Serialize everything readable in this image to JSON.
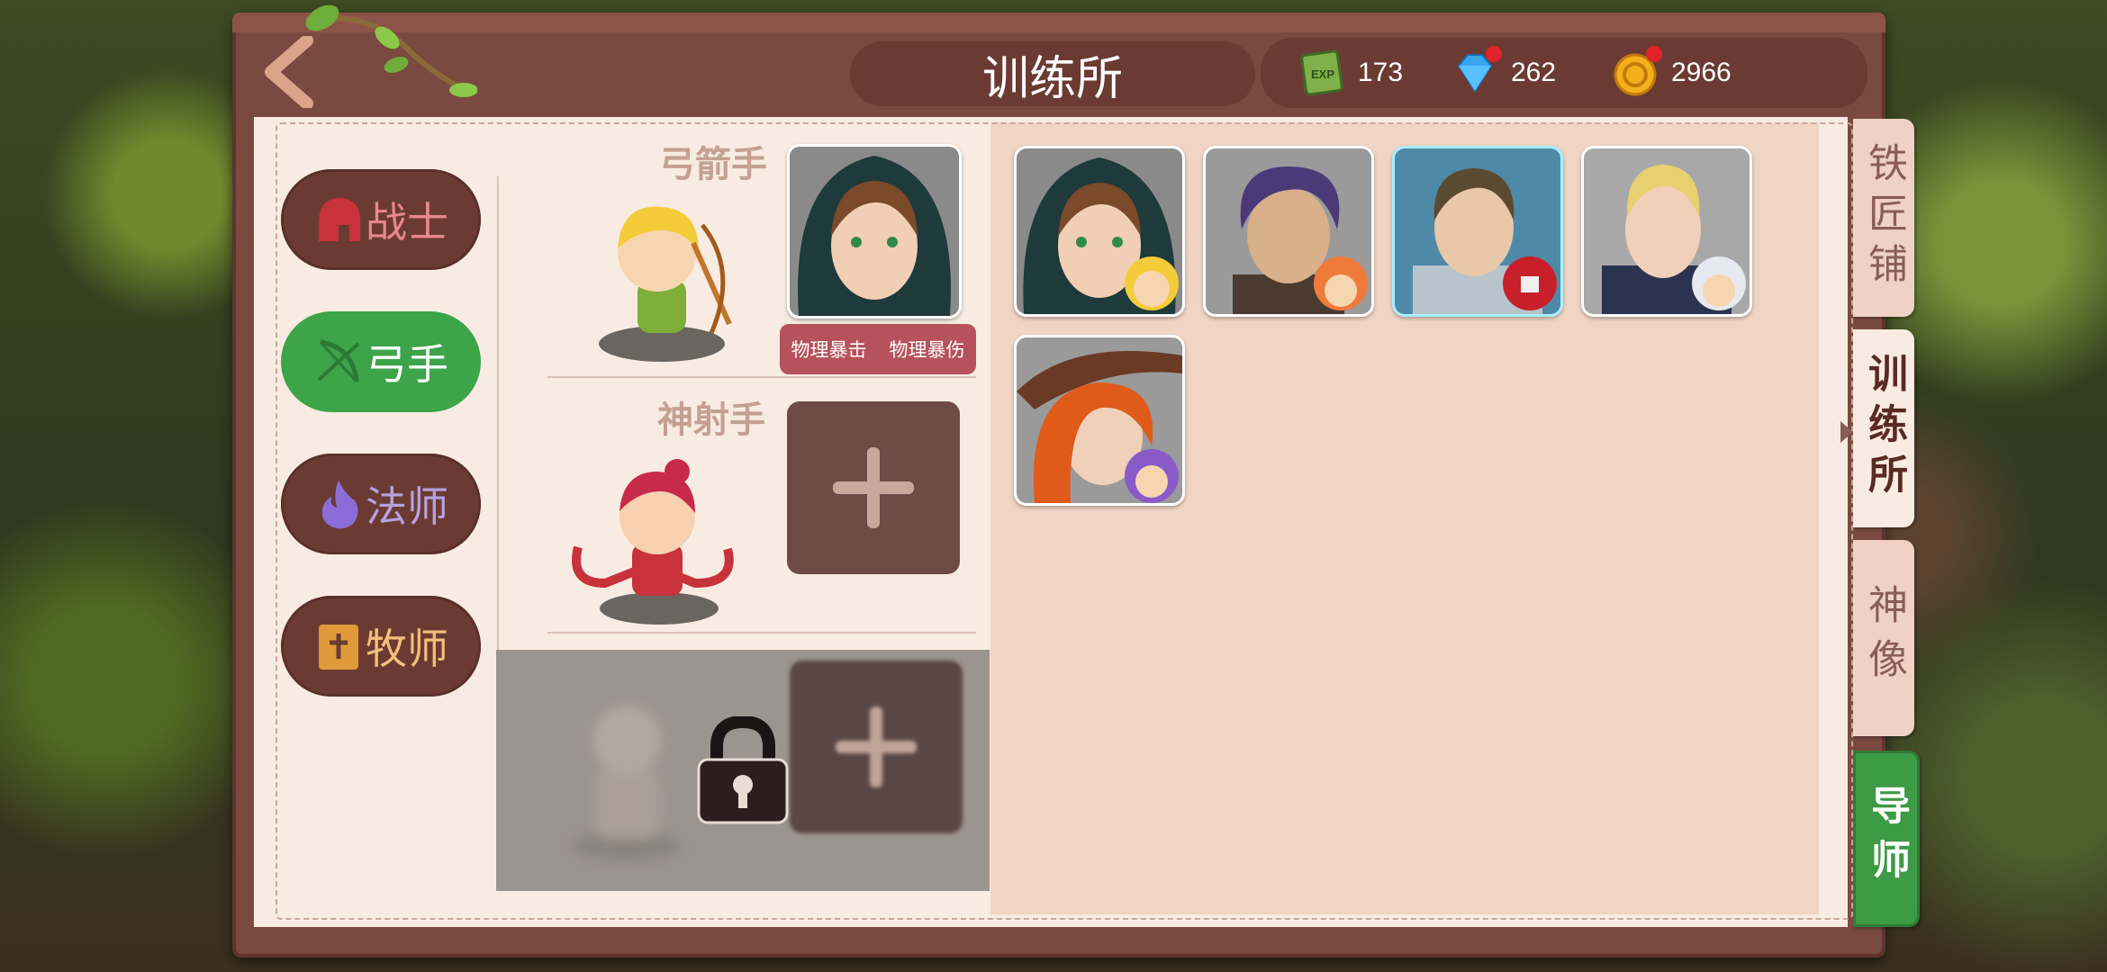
{
  "header": {
    "title": "训练所",
    "back_icon": "back-arrow-icon"
  },
  "currencies": [
    {
      "icon": "exp-book-icon",
      "value": "173",
      "has_dot": false
    },
    {
      "icon": "diamond-icon",
      "value": "262",
      "has_dot": true
    },
    {
      "icon": "gold-coin-icon",
      "value": "2966",
      "has_dot": true
    }
  ],
  "classes": [
    {
      "icon": "helmet-icon",
      "label": "战士",
      "active": false
    },
    {
      "icon": "bow-icon",
      "label": "弓手",
      "active": true
    },
    {
      "icon": "fire-icon",
      "label": "法师",
      "active": false
    },
    {
      "icon": "book-icon",
      "label": "牧师",
      "active": false
    }
  ],
  "slots": [
    {
      "title": "弓箭手",
      "filled": true,
      "tags": [
        "物理暴击",
        "物理暴伤"
      ]
    },
    {
      "title": "神射手",
      "filled": false
    },
    {
      "title": "",
      "locked": true
    }
  ],
  "side_tabs": [
    {
      "label": "铁匠铺",
      "active": false
    },
    {
      "label": "训练所",
      "active": true
    },
    {
      "label": "神像",
      "active": false
    },
    {
      "label": "导师",
      "active": false
    }
  ],
  "colors": {
    "frame": "#7a4a40",
    "panel": "#f8ece2",
    "roster_bg": "#f0d5c5",
    "active_green": "#3da44a",
    "tag_red": "#b5525b"
  }
}
